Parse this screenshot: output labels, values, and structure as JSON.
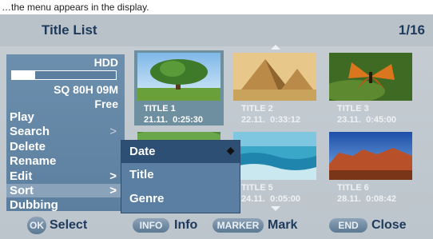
{
  "hint": "…the menu appears in the display.",
  "header": {
    "title": "Title List",
    "page_counter": "1/16"
  },
  "side_menu": {
    "disc": "HDD",
    "space_used_fraction": 0.22,
    "space_remaining": "SQ 80H 09M",
    "space_status": "Free",
    "items": [
      {
        "label": "Play",
        "arrow": ""
      },
      {
        "label": "Search",
        "arrow": ">"
      },
      {
        "label": "Delete",
        "arrow": ""
      },
      {
        "label": "Rename",
        "arrow": ""
      },
      {
        "label": "Edit",
        "arrow": ">"
      },
      {
        "label": "Sort",
        "arrow": ">"
      },
      {
        "label": "Dubbing",
        "arrow": ""
      }
    ],
    "highlighted_index": 5
  },
  "titles": [
    {
      "title": "TITLE 1",
      "date": "21.11.",
      "duration": "0:25:30",
      "scene": "tree",
      "selected": true
    },
    {
      "title": "TITLE 2",
      "date": "22.11.",
      "duration": "0:33:12",
      "scene": "pyramids",
      "selected": false
    },
    {
      "title": "TITLE 3",
      "date": "23.11.",
      "duration": "0:45:00",
      "scene": "butterfly",
      "selected": false
    },
    {
      "title": "",
      "date": "",
      "duration": "",
      "scene": "green",
      "selected": false
    },
    {
      "title": "TITLE 5",
      "date": "24.11.",
      "duration": "0:05:00",
      "scene": "ocean",
      "selected": false
    },
    {
      "title": "TITLE 6",
      "date": "28.11.",
      "duration": "0:08:42",
      "scene": "desert",
      "selected": false
    }
  ],
  "sort_popup": {
    "options": [
      "Date",
      "Title",
      "Genre"
    ],
    "active_index": 0,
    "marker": "◆"
  },
  "bottom_bar": {
    "keys": [
      {
        "key": "OK",
        "label": "Select"
      },
      {
        "key": "INFO",
        "label": "Info"
      },
      {
        "key": "MARKER",
        "label": "Mark"
      },
      {
        "key": "END",
        "label": "Close"
      }
    ]
  },
  "colors": {
    "accent": "#2d4f73",
    "menu": "#6d8fae",
    "text_dark": "#1d3a5c"
  }
}
